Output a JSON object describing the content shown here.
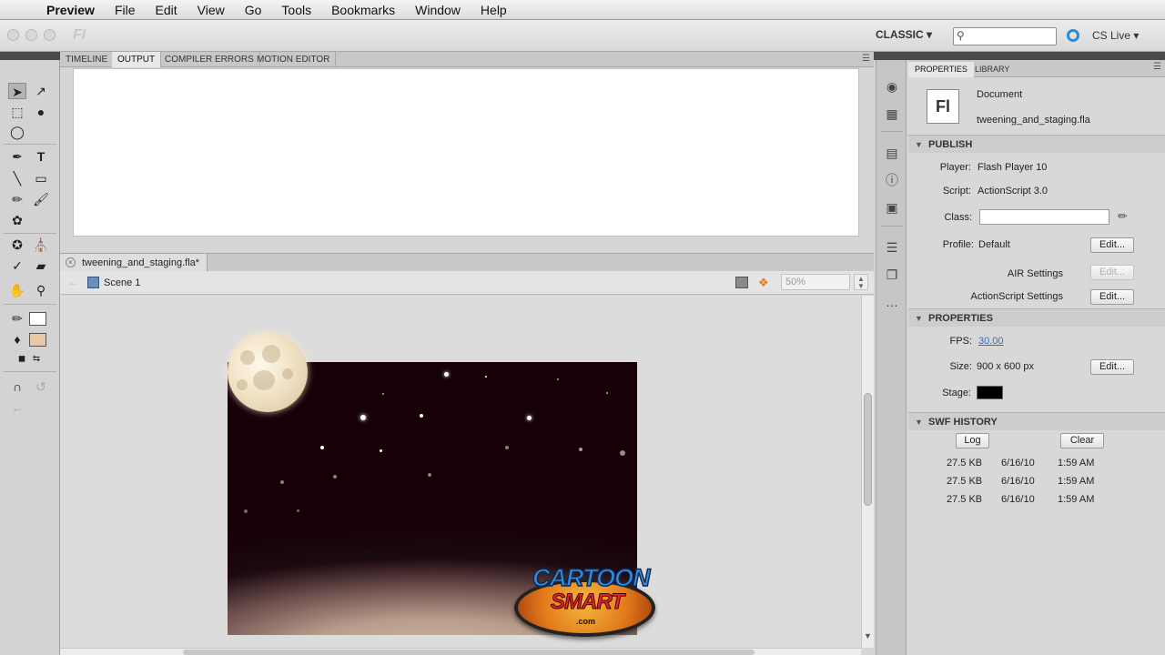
{
  "menubar": {
    "apple_icon": "",
    "app_name": "Preview",
    "items": [
      "File",
      "Edit",
      "View",
      "Go",
      "Tools",
      "Bookmarks",
      "Window",
      "Help"
    ]
  },
  "titlebar": {
    "app_ghost": "Fl",
    "workspace": "CLASSIC ▾",
    "search_placeholder": "",
    "cs_live": "CS Live ▾"
  },
  "panel_tabs": [
    "TIMELINE",
    "OUTPUT",
    "COMPILER ERRORS",
    "MOTION EDITOR"
  ],
  "active_panel_tab": "OUTPUT",
  "document": {
    "tab_label": "tweening_and_staging.fla*",
    "scene_label": "Scene 1",
    "zoom": "50%"
  },
  "stage": {
    "background_color": "#170007",
    "logo": {
      "line1": "CARTOON",
      "line2": "SMART",
      "line3": ".com"
    }
  },
  "properties_panel": {
    "tabs": [
      "PROPERTIES",
      "LIBRARY"
    ],
    "doc_icon": "Fl",
    "doc_type": "Document",
    "doc_name": "tweening_and_staging.fla",
    "publish": {
      "header": "PUBLISH",
      "player_label": "Player:",
      "player_value": "Flash Player 10",
      "script_label": "Script:",
      "script_value": "ActionScript 3.0",
      "class_label": "Class:",
      "class_value": "",
      "profile_label": "Profile:",
      "profile_value": "Default",
      "edit_label": "Edit...",
      "air_settings": "AIR Settings",
      "actionscript_settings": "ActionScript Settings"
    },
    "properties": {
      "header": "PROPERTIES",
      "fps_label": "FPS:",
      "fps_value": "30.00",
      "size_label": "Size:",
      "size_value": "900 x 600 px",
      "stage_label": "Stage:",
      "stage_color": "#000000"
    },
    "swf_history": {
      "header": "SWF HISTORY",
      "log_label": "Log",
      "clear_label": "Clear",
      "rows": [
        {
          "size": "27.5 KB",
          "date": "6/16/10",
          "time": "1:59 AM"
        },
        {
          "size": "27.5 KB",
          "date": "6/16/10",
          "time": "1:59 AM"
        },
        {
          "size": "27.5 KB",
          "date": "6/16/10",
          "time": "1:59 AM"
        }
      ]
    }
  },
  "colors": {
    "accent": "#2b8bd6",
    "link": "#2a72c9",
    "fill_swatch": "#e8c9a4"
  }
}
